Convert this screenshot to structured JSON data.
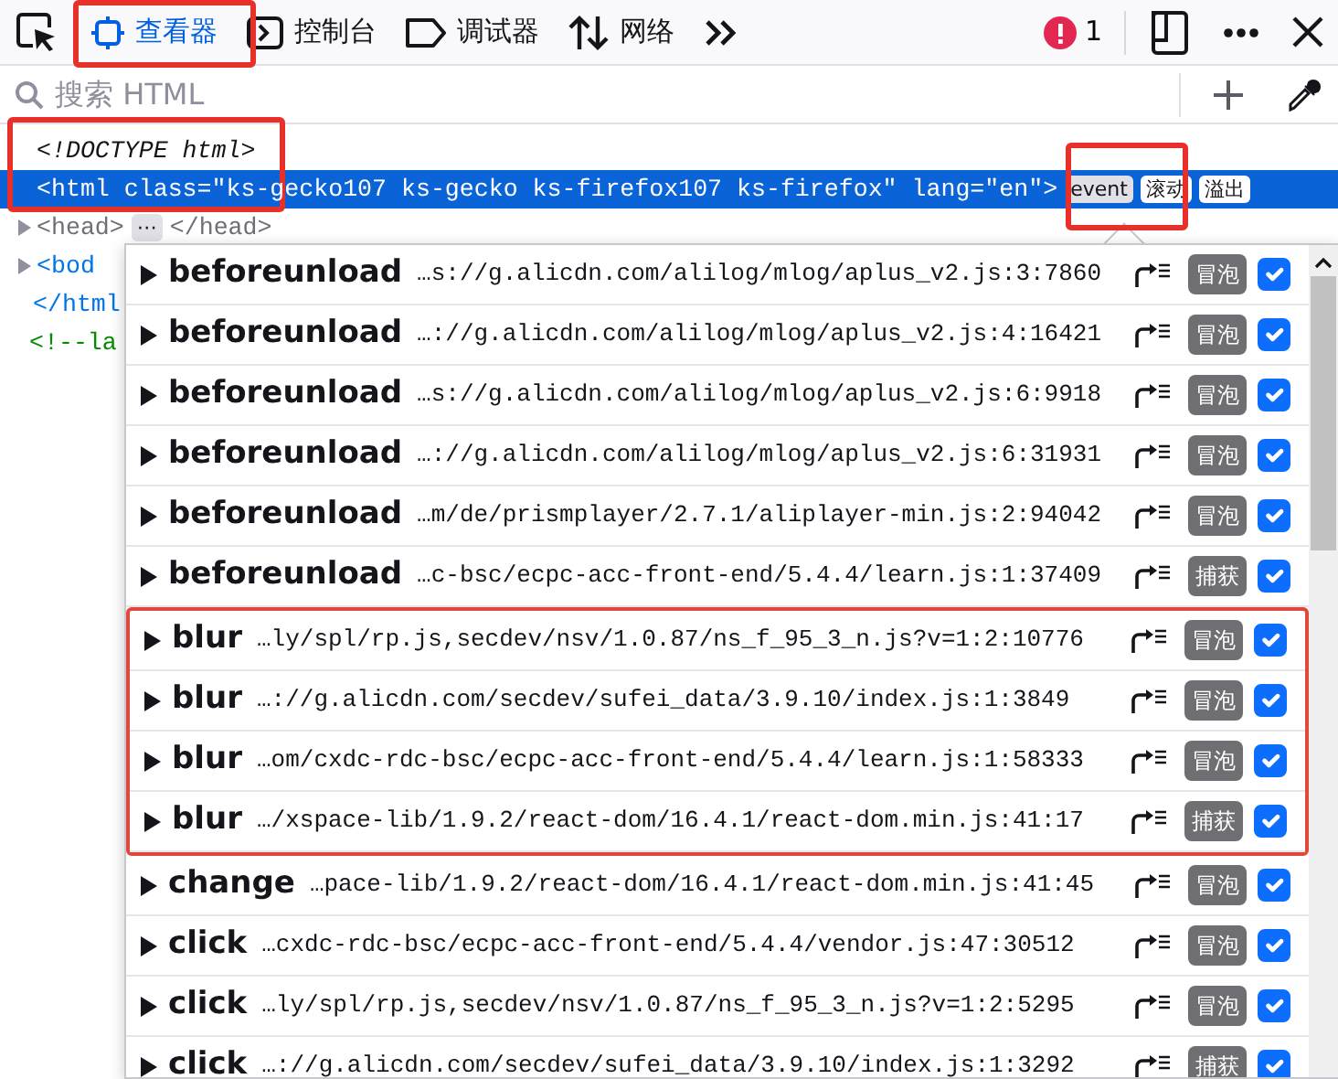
{
  "toolbar": {
    "tabs": [
      {
        "label": "查看器",
        "kind": "inspector",
        "selected": true
      },
      {
        "label": "控制台",
        "kind": "console",
        "selected": false
      },
      {
        "label": "调试器",
        "kind": "debugger",
        "selected": false
      },
      {
        "label": "网络",
        "kind": "network",
        "selected": false
      }
    ],
    "error_count": "1"
  },
  "search": {
    "placeholder": "搜索 HTML"
  },
  "markup": [
    {
      "kind": "doctype",
      "text": "<!DOCTYPE html>",
      "selected": false
    },
    {
      "kind": "open",
      "tag": "<html",
      "attrs": " class=\"ks-gecko107 ks-gecko ks-firefox107 ks-firefox\" lang=\"en\">",
      "badges": [
        "event",
        "滚动",
        "溢出"
      ],
      "selected": true
    },
    {
      "kind": "collapsed",
      "tag": "<head>",
      "ellipsis": "⋯",
      "close": "</head>",
      "selected": false
    },
    {
      "kind": "partial",
      "tag": "<bod",
      "selected": false
    },
    {
      "kind": "close",
      "tag": "</html",
      "selected": false
    },
    {
      "kind": "comment",
      "tag": "<!--la",
      "selected": false
    }
  ],
  "event_popup": {
    "rows": [
      {
        "event": "beforeunload",
        "source": "…s://g.alicdn.com/alilog/mlog/aplus_v2.js:3:7860",
        "phase": "冒泡",
        "checked": true,
        "annotated": false
      },
      {
        "event": "beforeunload",
        "source": "…://g.alicdn.com/alilog/mlog/aplus_v2.js:4:16421",
        "phase": "冒泡",
        "checked": true,
        "annotated": false
      },
      {
        "event": "beforeunload",
        "source": "…s://g.alicdn.com/alilog/mlog/aplus_v2.js:6:9918",
        "phase": "冒泡",
        "checked": true,
        "annotated": false
      },
      {
        "event": "beforeunload",
        "source": "…://g.alicdn.com/alilog/mlog/aplus_v2.js:6:31931",
        "phase": "冒泡",
        "checked": true,
        "annotated": false
      },
      {
        "event": "beforeunload",
        "source": "…m/de/prismplayer/2.7.1/aliplayer-min.js:2:94042",
        "phase": "冒泡",
        "checked": true,
        "annotated": false
      },
      {
        "event": "beforeunload",
        "source": "…c-bsc/ecpc-acc-front-end/5.4.4/learn.js:1:37409",
        "phase": "捕获",
        "checked": true,
        "annotated": false
      },
      {
        "event": "blur",
        "source": "…ly/spl/rp.js,secdev/nsv/1.0.87/ns_f_95_3_n.js?v=1:2:10776",
        "phase": "冒泡",
        "checked": true,
        "annotated": true
      },
      {
        "event": "blur",
        "source": "…://g.alicdn.com/secdev/sufei_data/3.9.10/index.js:1:3849",
        "phase": "冒泡",
        "checked": true,
        "annotated": true
      },
      {
        "event": "blur",
        "source": "…om/cxdc-rdc-bsc/ecpc-acc-front-end/5.4.4/learn.js:1:58333",
        "phase": "冒泡",
        "checked": true,
        "annotated": true
      },
      {
        "event": "blur",
        "source": "…/xspace-lib/1.9.2/react-dom/16.4.1/react-dom.min.js:41:17",
        "phase": "捕获",
        "checked": true,
        "annotated": true
      },
      {
        "event": "change",
        "source": "…pace-lib/1.9.2/react-dom/16.4.1/react-dom.min.js:41:45",
        "phase": "冒泡",
        "checked": true,
        "annotated": false
      },
      {
        "event": "click",
        "source": "…cxdc-rdc-bsc/ecpc-acc-front-end/5.4.4/vendor.js:47:30512",
        "phase": "冒泡",
        "checked": true,
        "annotated": false
      },
      {
        "event": "click",
        "source": "…ly/spl/rp.js,secdev/nsv/1.0.87/ns_f_95_3_n.js?v=1:2:5295",
        "phase": "冒泡",
        "checked": true,
        "annotated": false
      },
      {
        "event": "click",
        "source": "…://g.alicdn.com/secdev/sufei_data/3.9.10/index.js:1:3292",
        "phase": "捕获",
        "checked": true,
        "annotated": false
      }
    ]
  }
}
